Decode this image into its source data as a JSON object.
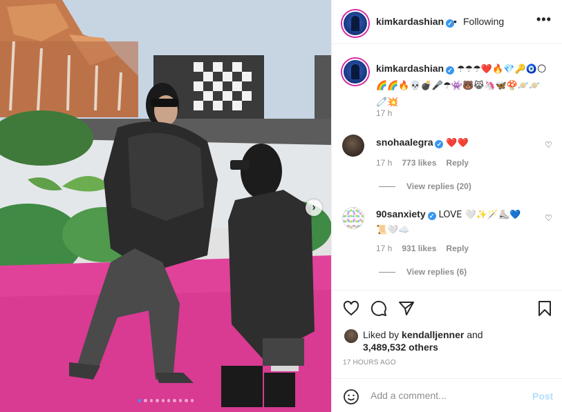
{
  "post": {
    "author": "kimkardashian",
    "follow_status": "Following",
    "more_label": "•••",
    "separator": "•",
    "next_label": "›",
    "carousel_total": 10,
    "carousel_index": 1
  },
  "caption": {
    "username": "kimkardashian",
    "emoji_text": "☂☂☂❤️🔥💎🔑🧿🌕🌈🌈🔥💀💣🎤☂👾🐻😹🦄🦋🍄🪐🪐🧷💥",
    "time": "17 h"
  },
  "comments": [
    {
      "username": "snohaalegra",
      "text": "❤️❤️",
      "time": "17 h",
      "likes": "773 likes",
      "reply": "Reply",
      "replies": "View replies (20)"
    },
    {
      "username": "90sanxiety",
      "text": "LOVE 🤍✨🪄⛸️💙📜🤍☁️",
      "time": "17 h",
      "likes": "931 likes",
      "reply": "Reply",
      "replies": "View replies (6)"
    }
  ],
  "likes": {
    "prefix": "Liked by",
    "user": "kendalljenner",
    "conj": "and",
    "others": "3,489,532 others"
  },
  "age": "17 HOURS AGO",
  "add_comment": {
    "placeholder": "Add a comment...",
    "post_label": "Post"
  },
  "colors": {
    "verified": "#3897f0",
    "carpet": "#e0429a",
    "post_button": "#b2dffc"
  },
  "icons": [
    "heart-icon",
    "comment-icon",
    "share-icon",
    "bookmark-icon",
    "smile-icon",
    "verified-icon",
    "more-icon"
  ]
}
